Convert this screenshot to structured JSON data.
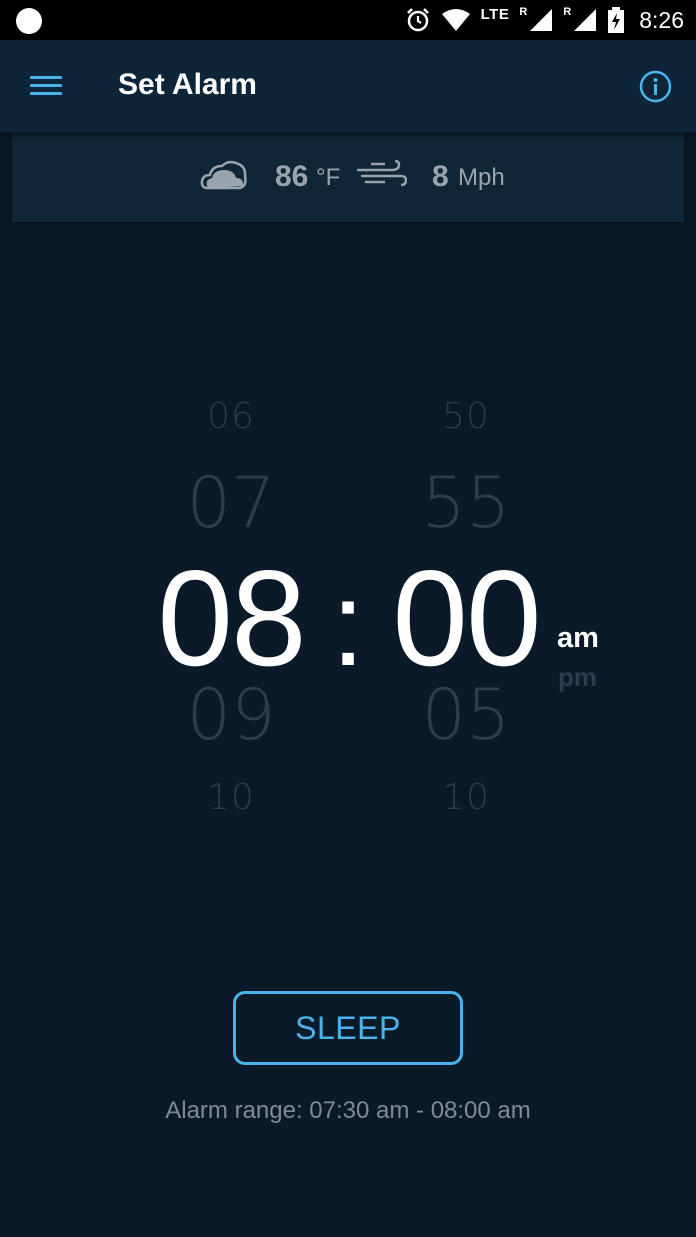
{
  "status_bar": {
    "network": "LTE",
    "roaming_1": "R",
    "roaming_2": "R",
    "time": "8:26"
  },
  "app_bar": {
    "title": "Set Alarm",
    "menu_icon": "hamburger-menu-icon",
    "info_icon": "info-icon"
  },
  "weather": {
    "condition_icon": "cloud-icon",
    "temperature": "86",
    "temperature_unit": "°F",
    "wind_icon": "wind-icon",
    "wind_speed": "8",
    "wind_unit": "Mph"
  },
  "time_picker": {
    "hours": {
      "above_far": "06",
      "above_near": "07",
      "selected": "08",
      "below_near": "09",
      "below_far": "10"
    },
    "separator": ":",
    "minutes": {
      "above_far": "50",
      "above_near": "55",
      "selected": "00",
      "below_near": "05",
      "below_far": "10"
    },
    "period_selected": "am",
    "period_other": "pm"
  },
  "sleep_button_label": "SLEEP",
  "alarm_range": "Alarm range: 07:30 am - 08:00 am",
  "colors": {
    "accent": "#4bb3ec",
    "background": "#0b1a29",
    "app_bar": "#0e2439",
    "muted_text": "#7f8a95"
  }
}
